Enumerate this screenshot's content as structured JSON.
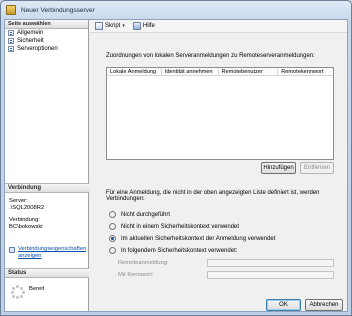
{
  "window": {
    "title": "Neuer Verbindungsserver"
  },
  "left_pane": {
    "header": "Seite auswählen",
    "pages": [
      "Allgemein",
      "Sicherheit",
      "Serveroptionen"
    ],
    "connection": {
      "header": "Verbindung",
      "server_label": "Server:",
      "server_value": ".\\SQL2008R2",
      "connection_label": "Verbindung:",
      "connection_value": "BC\\bokowski",
      "link_line1": "Verbindungseigenschaften",
      "link_line2": "anzeigen"
    },
    "status": {
      "header": "Status",
      "value": "Bereit"
    }
  },
  "toolbar": {
    "script_label": "Skript",
    "help_label": "Hilfe"
  },
  "mappings": {
    "caption": "Zuordnungen von lokalen Serveranmeldungen zu Remoteserveranmeldungen:",
    "columns": [
      "Lokale Anmeldung",
      "Identität annehmen",
      "Remotebenutzer",
      "Remotekennwort"
    ],
    "add_button": "Hinzufügen",
    "remove_button": "Entfernen"
  },
  "other_logins": {
    "caption": "Für eine Anmeldung, die nicht in der oben angezeigten Liste definiert ist, werden Verbindungen:",
    "options": [
      {
        "label": "Nicht durchgeführt",
        "checked": false
      },
      {
        "label": "Nicht in einem Sicherheitskontext verwendet",
        "checked": false
      },
      {
        "label": "Im aktuellen Sicherheitskontext der Anmeldung verwendet",
        "checked": true
      },
      {
        "label": "In folgendem Sicherheitskontext verwendet:",
        "checked": false
      }
    ],
    "remote_login_label": "Remoteanmeldung:",
    "password_label": "Mit Kennwort:"
  },
  "footer": {
    "ok_label": "OK",
    "cancel_label": "Abbrechen"
  }
}
